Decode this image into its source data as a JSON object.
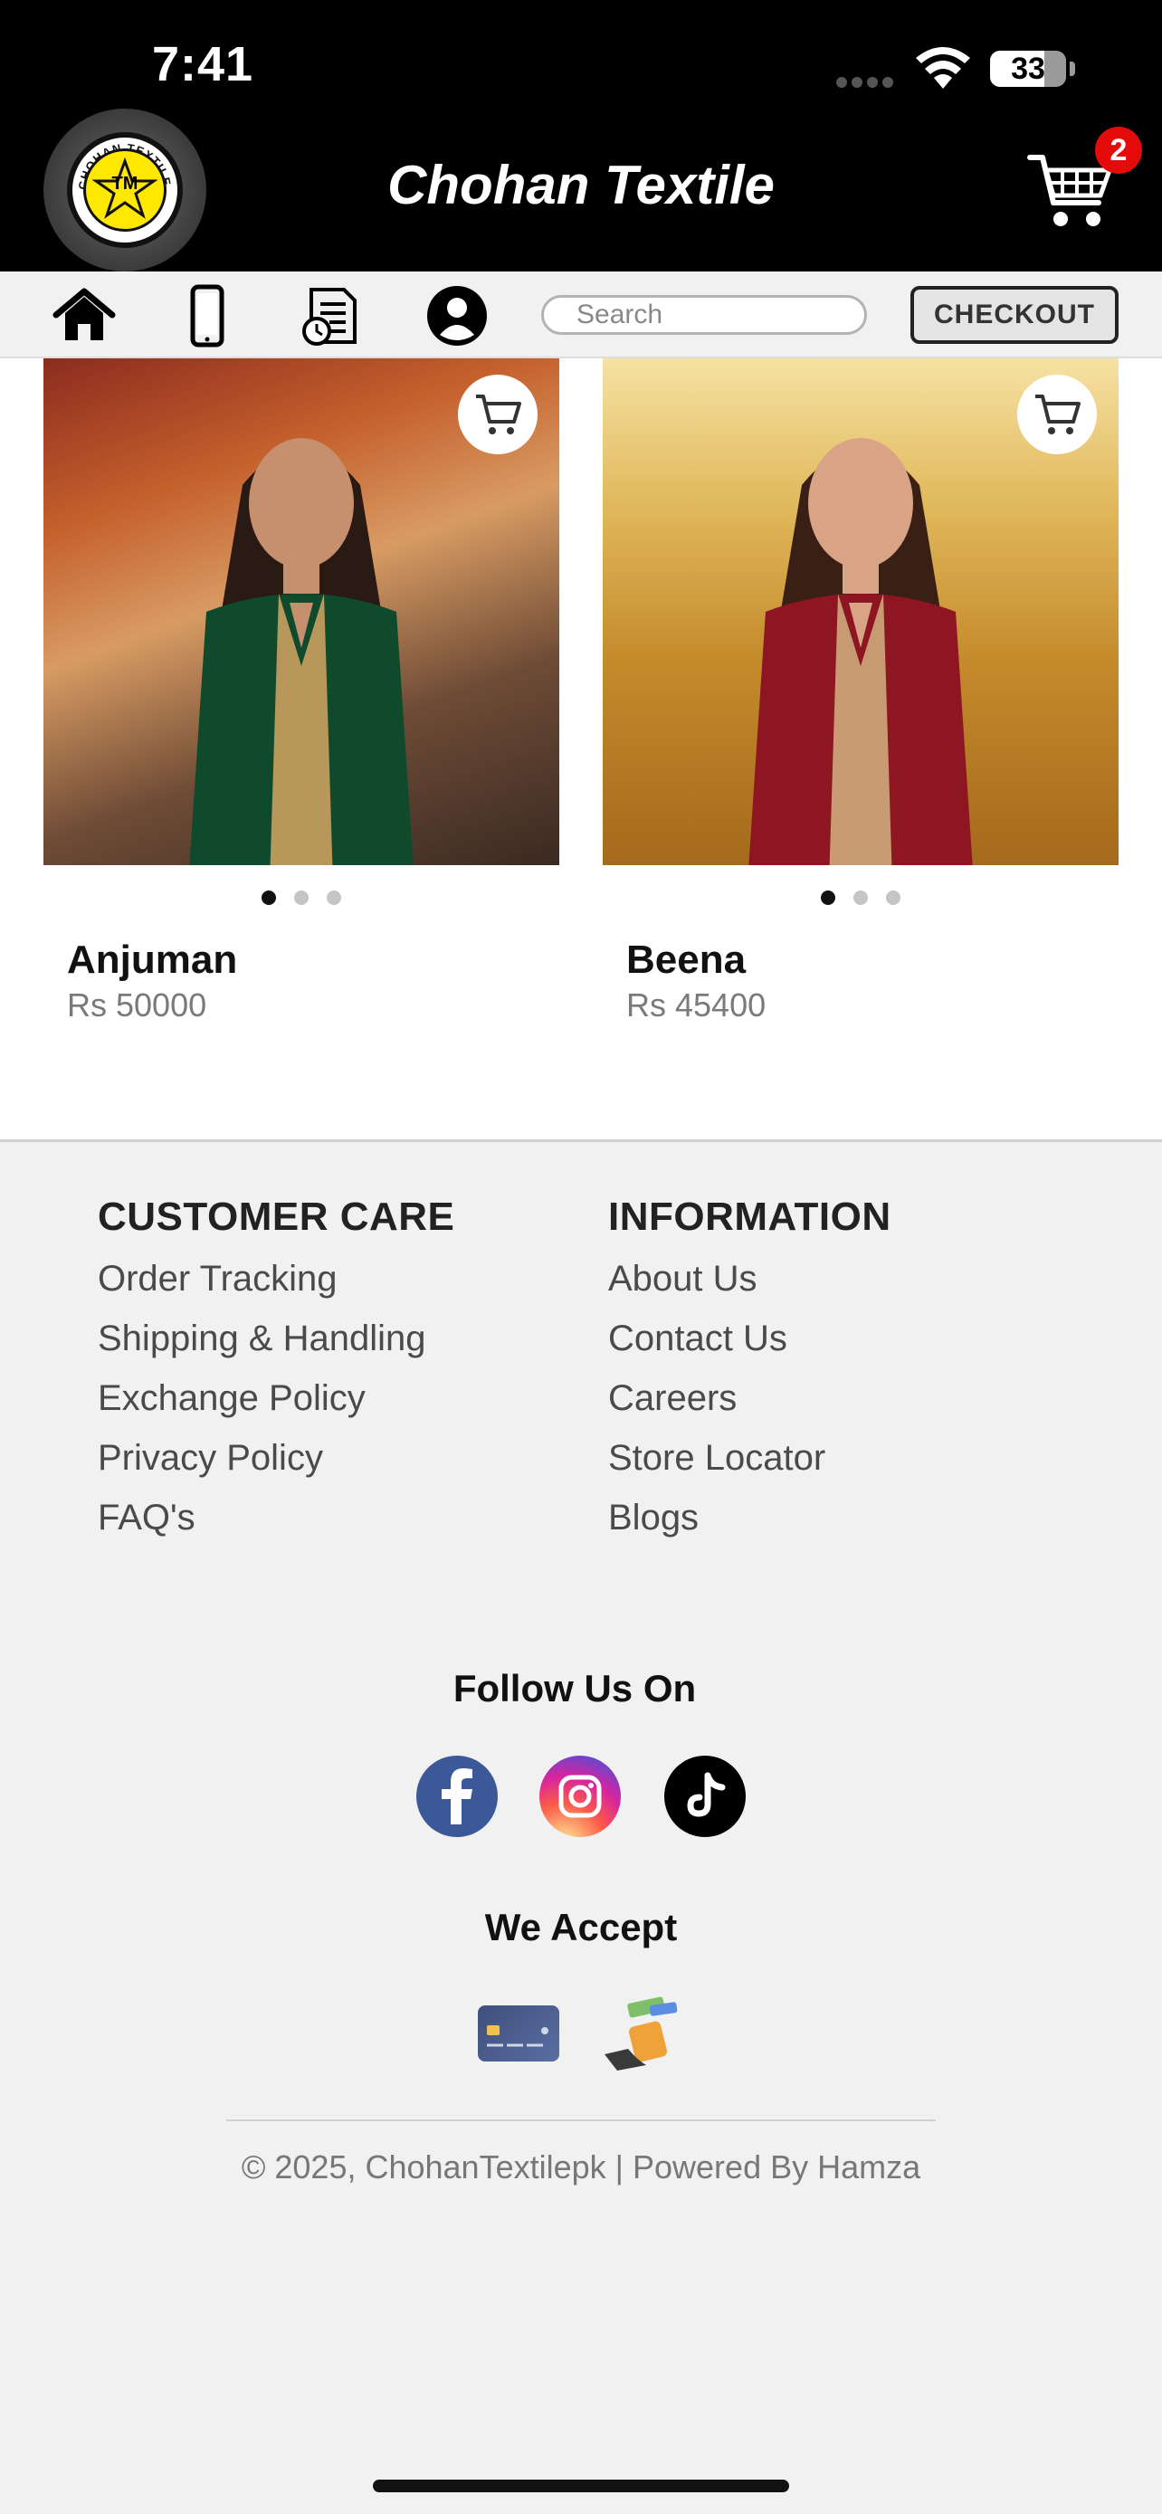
{
  "status_bar": {
    "time": "7:41",
    "battery": "33"
  },
  "header": {
    "logo_text": "CHOHAN TEXTILE",
    "logo_mark": "TM",
    "title": "Chohan Textile",
    "cart_count": "2"
  },
  "toolbar": {
    "search_placeholder": "Search",
    "checkout_label": "CHECKOUT",
    "icons": [
      "home-icon",
      "phone-icon",
      "order-history-icon",
      "account-icon"
    ]
  },
  "products": [
    {
      "name": "Anjuman",
      "price": "Rs 50000",
      "dots": 3,
      "active_dot": 0
    },
    {
      "name": "Beena",
      "price": "Rs 45400",
      "dots": 3,
      "active_dot": 0
    }
  ],
  "footer": {
    "customer_care": {
      "heading": "CUSTOMER CARE",
      "links": [
        "Order Tracking",
        "Shipping & Handling",
        "Exchange Policy",
        "Privacy Policy",
        "FAQ's"
      ]
    },
    "information": {
      "heading": "INFORMATION",
      "links": [
        "About Us",
        "Contact Us",
        "Careers",
        "Store Locator",
        "Blogs"
      ]
    },
    "follow_heading": "Follow Us On",
    "social": [
      "facebook-icon",
      "instagram-icon",
      "tiktok-icon"
    ],
    "accept_heading": "We Accept",
    "payment_methods": [
      "credit-card-icon",
      "cash-icon"
    ],
    "copyright": "© 2025, ChohanTextilepk | Powered By Hamza"
  },
  "colors": {
    "header_bg": "#000000",
    "badge": "#e60b0b",
    "page_bg": "#f1f1f1"
  }
}
